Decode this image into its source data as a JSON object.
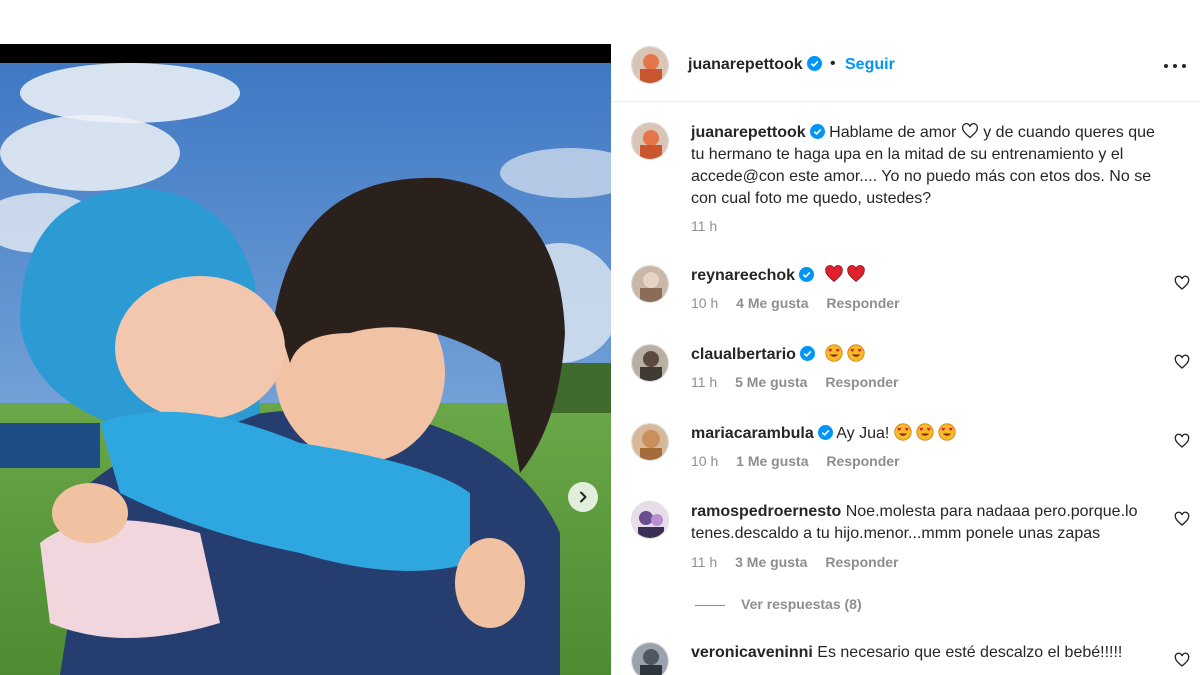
{
  "post": {
    "username": "juanarepettook",
    "follow_label": "Seguir",
    "dot": "•"
  },
  "caption": {
    "username": "juanarepettook",
    "text_part1": "Hablame de amor",
    "text_part2": "y de cuando queres que tu hermano te haga upa en la mitad de su entrenamiento y el accede@con este amor.... Yo no puedo más con etos dos. No se con cual foto me quedo, ustedes?",
    "time": "11 h"
  },
  "comments": [
    {
      "username": "reynareechok",
      "verified": true,
      "text": "",
      "emoji": [
        "heart",
        "heart"
      ],
      "time": "10 h",
      "likes": "4 Me gusta",
      "reply": "Responder"
    },
    {
      "username": "claualbertario",
      "verified": true,
      "text": "",
      "emoji": [
        "heart-eyes",
        "heart-eyes"
      ],
      "time": "11 h",
      "likes": "5 Me gusta",
      "reply": "Responder"
    },
    {
      "username": "mariacarambula",
      "verified": true,
      "text": "Ay Jua!",
      "emoji": [
        "heart-eyes",
        "heart-eyes",
        "heart-eyes"
      ],
      "time": "10 h",
      "likes": "1 Me gusta",
      "reply": "Responder"
    },
    {
      "username": "ramospedroernesto",
      "verified": false,
      "text": "Noe.molesta para nadaaa pero.porque.lo tenes.descaldo a tu hijo.menor...mmm ponele unas zapas",
      "emoji": [],
      "time": "11 h",
      "likes": "3 Me gusta",
      "reply": "Responder"
    },
    {
      "username": "veronicaveninni",
      "verified": false,
      "text": "Es necesario que esté descalzo el bebé!!!!!",
      "emoji": [],
      "time": "",
      "likes": "",
      "reply": ""
    }
  ],
  "view_replies": "Ver respuestas (8)",
  "colors": {
    "link_blue": "#0095f6",
    "verified_blue": "#0095f6",
    "muted": "#8e8e8e",
    "heart_red": "#ed4956"
  }
}
